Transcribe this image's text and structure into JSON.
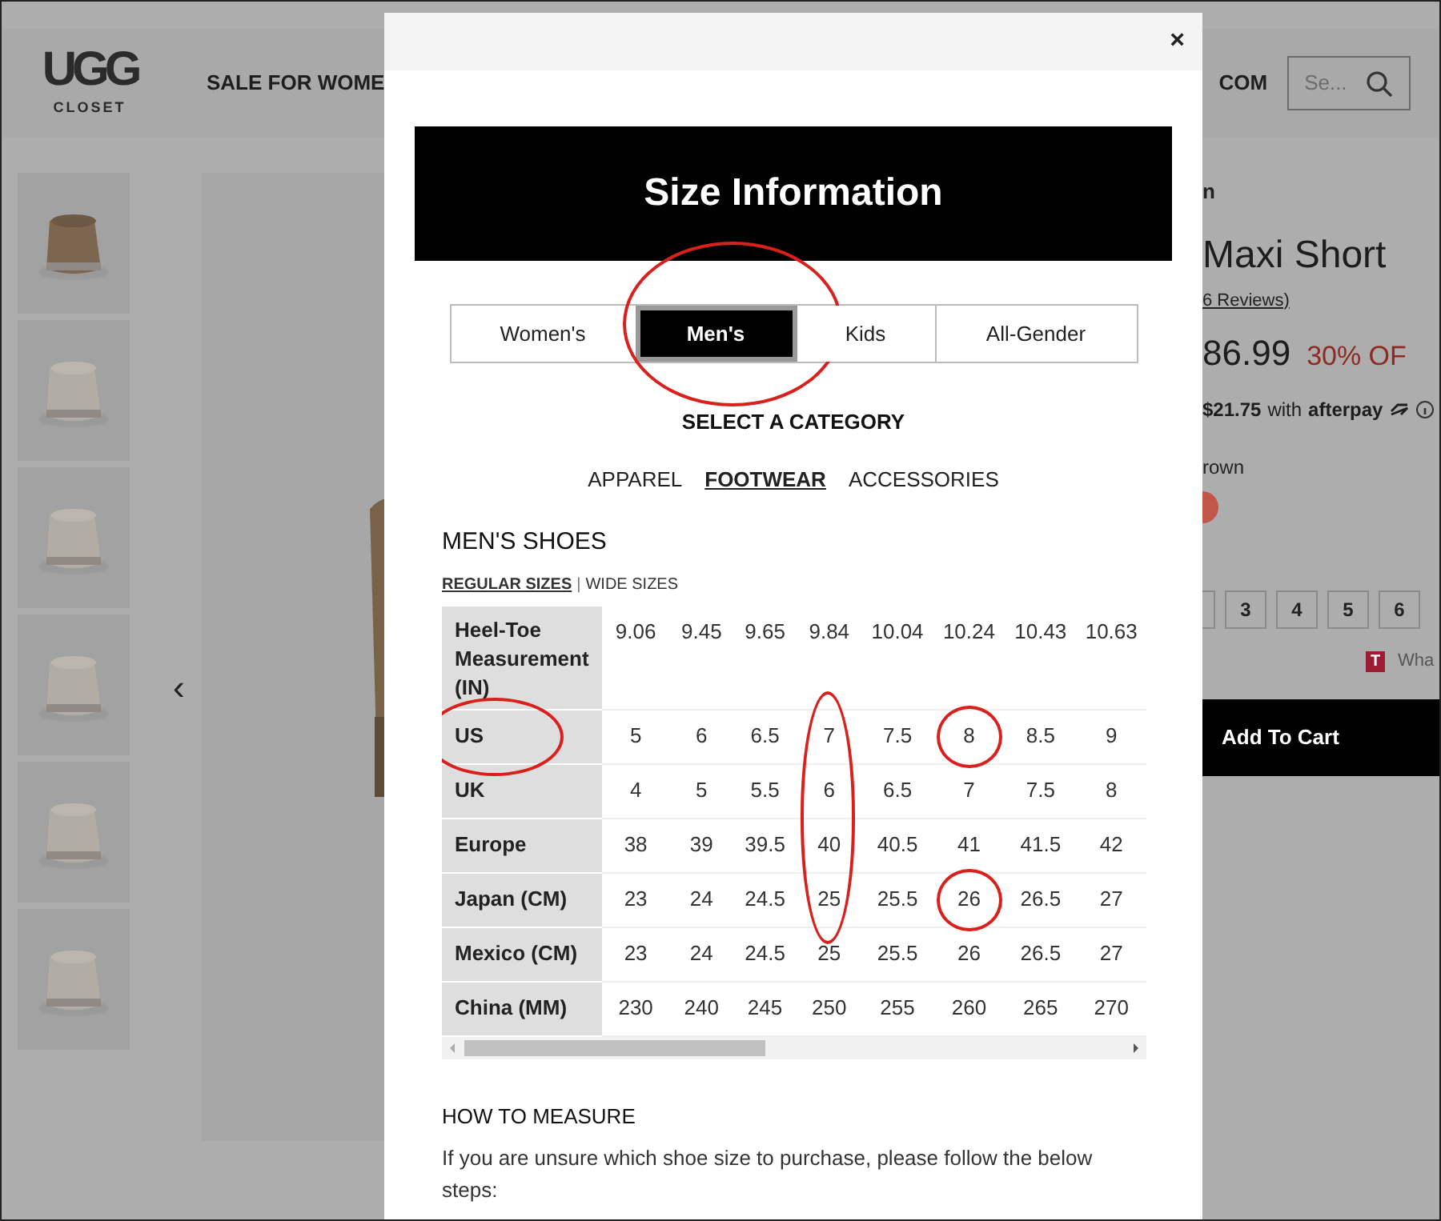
{
  "site": {
    "logo_word": "UGG",
    "logo_sub": "CLOSET",
    "nav": [
      "SALE FOR WOME",
      "COM"
    ],
    "search": {
      "placeholder": "Se..."
    }
  },
  "product": {
    "brand": "n",
    "title": "Maxi Short",
    "reviews": "6 Reviews)",
    "price": "86.99",
    "discount": "30% OF",
    "installment": "$21.75",
    "installment_text": "with",
    "pay_brand": "afterpay",
    "color_name": "rown",
    "sizes": [
      "3",
      "4",
      "5",
      "6"
    ],
    "note": "Wha",
    "badge": "T",
    "prev_arrow": "‹",
    "add_to_cart": "Add To Cart"
  },
  "modal": {
    "close": "×",
    "title": "Size Information",
    "tabs": [
      {
        "label": "Women's",
        "selected": false,
        "circled": false
      },
      {
        "label": "Men's",
        "selected": true,
        "circled": true
      },
      {
        "label": "Kids",
        "selected": false,
        "circled": false
      },
      {
        "label": "All-Gender",
        "selected": false,
        "circled": false
      }
    ],
    "category_prompt": "SELECT A CATEGORY",
    "categories": [
      {
        "label": "APPAREL",
        "selected": false
      },
      {
        "label": "FOOTWEAR",
        "selected": true
      },
      {
        "label": "ACCESSORIES",
        "selected": false
      }
    ],
    "section_title": "MEN'S SHOES",
    "size_types": [
      {
        "label": "REGULAR SIZES",
        "selected": true
      },
      {
        "label": "WIDE SIZES",
        "selected": false
      }
    ],
    "size_type_separator": "|",
    "table": {
      "rows": [
        {
          "label": "Heel-Toe Measurement (IN)",
          "circled": false,
          "cells": [
            "9.06",
            "9.45",
            "9.65",
            "9.84",
            "10.04",
            "10.24",
            "10.43",
            "10.63"
          ]
        },
        {
          "label": "US",
          "circled": true,
          "cells": [
            "5",
            "6",
            "6.5",
            {
              "text": "7",
              "column_circle": true
            },
            "7.5",
            {
              "text": "8",
              "circled": true
            },
            "8.5",
            "9"
          ]
        },
        {
          "label": "UK",
          "circled": false,
          "cells": [
            "4",
            "5",
            "5.5",
            {
              "text": "6",
              "column_circle": true
            },
            "6.5",
            "7",
            "7.5",
            "8"
          ]
        },
        {
          "label": "Europe",
          "circled": false,
          "cells": [
            "38",
            "39",
            "39.5",
            {
              "text": "40",
              "column_circle": true
            },
            "40.5",
            "41",
            "41.5",
            "42"
          ]
        },
        {
          "label": "Japan (CM)",
          "circled": false,
          "cells": [
            "23",
            "24",
            "24.5",
            {
              "text": "25",
              "column_circle": true
            },
            "25.5",
            {
              "text": "26",
              "circled": true
            },
            "26.5",
            "27"
          ]
        },
        {
          "label": "Mexico (CM)",
          "circled": false,
          "cells": [
            "23",
            "24",
            "24.5",
            "25",
            "25.5",
            "26",
            "26.5",
            "27"
          ]
        },
        {
          "label": "China (MM)",
          "circled": false,
          "cells": [
            "230",
            "240",
            "245",
            "250",
            "255",
            "260",
            "265",
            "270"
          ]
        }
      ]
    },
    "how_to_title": "HOW TO MEASURE",
    "how_to_text": "If you are unsure which shoe size to purchase, please follow the below steps:"
  }
}
